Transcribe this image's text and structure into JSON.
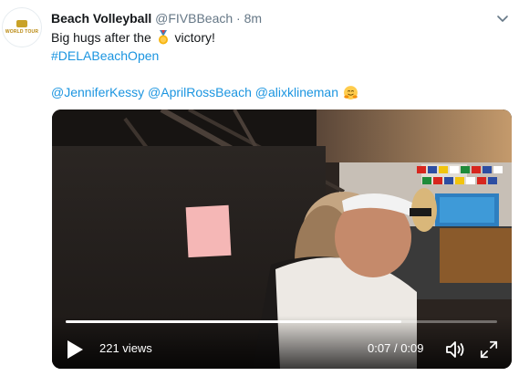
{
  "tweet": {
    "display_name": "Beach Volleyball",
    "handle": "@FIVBBeach",
    "separator": "·",
    "time": "8m",
    "avatar_text": "WORLD TOUR",
    "text_before_emoji": "Big hugs after the",
    "medal_icon": "first-place-medal",
    "text_after_emoji": "victory!",
    "hashtag": "#DELABeachOpen",
    "mentions": [
      "@JenniferKessy",
      "@AprilRossBeach",
      "@alixklineman"
    ],
    "hug_icon": "hugging-face"
  },
  "video": {
    "views": "221 views",
    "current_time": "0:07",
    "time_separator": "/",
    "duration": "0:09",
    "progress_fraction": 0.778
  },
  "colors": {
    "link": "#1b95e0",
    "muted": "#657786",
    "text": "#14171a",
    "medal_gold": "#f6b40e",
    "ribbon_blue": "#3b88c3"
  }
}
